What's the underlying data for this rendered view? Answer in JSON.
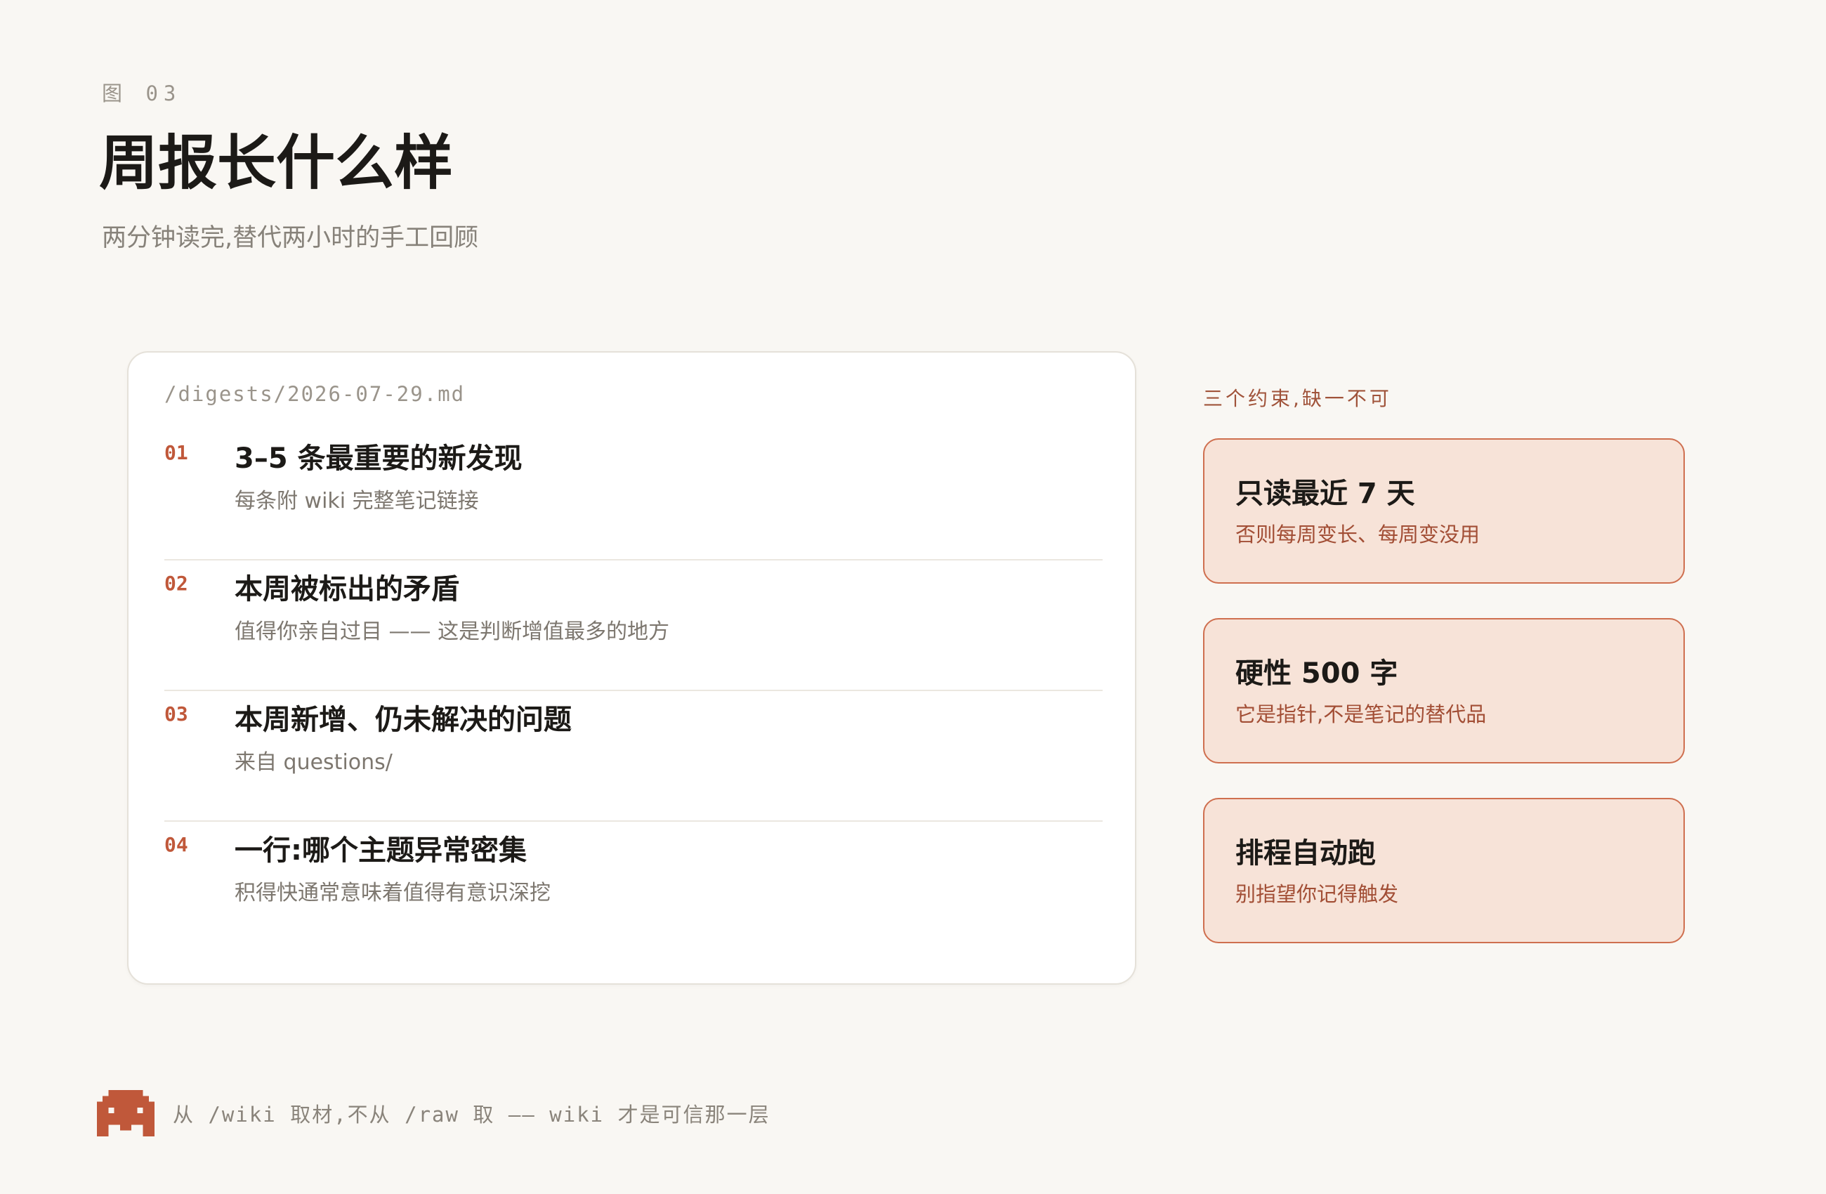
{
  "header": {
    "figure_label": "图 03",
    "title": "周报长什么样",
    "subtitle": "两分钟读完,替代两小时的手工回顾"
  },
  "digest": {
    "path": "/digests/2026-07-29.md",
    "items": [
      {
        "num": "01",
        "title": "3–5 条最重要的新发现",
        "desc": "每条附 wiki 完整笔记链接"
      },
      {
        "num": "02",
        "title": "本周被标出的矛盾",
        "desc": "值得你亲自过目 —— 这是判断增值最多的地方"
      },
      {
        "num": "03",
        "title": "本周新增、仍未解决的问题",
        "desc": "来自 questions/"
      },
      {
        "num": "04",
        "title": "一行:哪个主题异常密集",
        "desc": "积得快通常意味着值得有意识深挖"
      }
    ]
  },
  "constraints": {
    "heading": "三个约束,缺一不可",
    "items": [
      {
        "title": "只读最近 7 天",
        "desc": "否则每周变长、每周变没用"
      },
      {
        "title": "硬性 500 字",
        "desc": "它是指针,不是笔记的替代品"
      },
      {
        "title": "排程自动跑",
        "desc": "别指望你记得触发"
      }
    ]
  },
  "footer": {
    "icon": "pixel-mascot-icon",
    "note": "从 /wiki 取材,不从 /raw 取 —— wiki 才是可信那一层"
  },
  "colors": {
    "accent": "#c0583a",
    "background": "#f9f7f3",
    "card_fill": "#f7e3d8",
    "card_border": "#cf6f4f"
  }
}
